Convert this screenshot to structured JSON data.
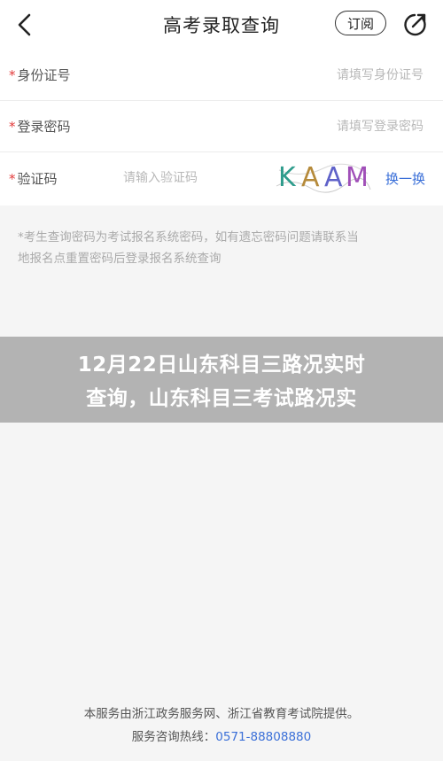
{
  "header": {
    "title": "高考录取查询",
    "subscribe_label": "订阅",
    "back_icon": "back-arrow-icon",
    "share_icon": "share-icon"
  },
  "form": {
    "required_mark": "*",
    "id_label": "身份证号",
    "id_placeholder": "请填写身份证号",
    "password_label": "登录密码",
    "password_placeholder": "请填写登录密码",
    "captcha_label": "验证码",
    "captcha_placeholder": "请输入验证码",
    "captcha_text": [
      "K",
      "A",
      "A",
      "M"
    ],
    "refresh_label": "换一换"
  },
  "note": {
    "line1": "*考生查询密码为考试报名系统密码，如有遗忘密码问题请联系当",
    "line2": "地报名点重置密码后登录报名系统查询"
  },
  "headline": {
    "line1": "12月22日山东科目三路况实时",
    "line2": "查询，山东科目三考试路况实"
  },
  "footer": {
    "provider": "本服务由浙江政务服务网、浙江省教育考试院提供。",
    "hotline_label": "服务咨询热线：",
    "hotline_number": "0571-88808880"
  },
  "colors": {
    "accent": "#3a6fd8",
    "required": "#e23b3b",
    "overlay": "#a0a0a0"
  }
}
